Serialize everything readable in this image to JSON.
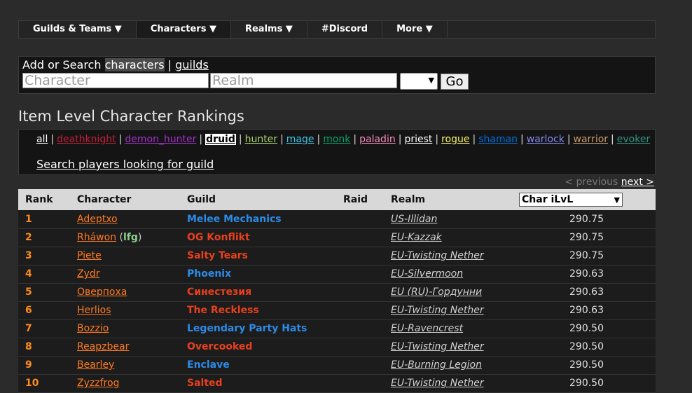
{
  "nav": {
    "items": [
      {
        "label": "Guilds & Teams ▼"
      },
      {
        "label": "Characters ▼"
      },
      {
        "label": "Realms ▼"
      },
      {
        "label": "#Discord"
      },
      {
        "label": "More ▼"
      }
    ]
  },
  "search": {
    "prefix": "Add or Search",
    "characters_link": "characters",
    "separator": "|",
    "guilds_link": "guilds",
    "character_placeholder": "Character",
    "realm_placeholder": "Realm",
    "region_value": "",
    "go_label": "Go"
  },
  "page_title": "Item Level Character Rankings",
  "classes": {
    "items": [
      {
        "label": "all",
        "color": "#ffffff"
      },
      {
        "label": "deathknight",
        "color": "#c41e3a"
      },
      {
        "label": "demon_hunter",
        "color": "#a330c9"
      },
      {
        "label": "druid",
        "color": "#000000"
      },
      {
        "label": "hunter",
        "color": "#aad372"
      },
      {
        "label": "mage",
        "color": "#3fc7eb"
      },
      {
        "label": "monk",
        "color": "#00a36c"
      },
      {
        "label": "paladin",
        "color": "#f48cba"
      },
      {
        "label": "priest",
        "color": "#ffffff"
      },
      {
        "label": "rogue",
        "color": "#fff468"
      },
      {
        "label": "shaman",
        "color": "#0070dd"
      },
      {
        "label": "warlock",
        "color": "#8788ee"
      },
      {
        "label": "warrior",
        "color": "#c69b6d"
      },
      {
        "label": "evoker",
        "color": "#33937f"
      }
    ],
    "lfg_link": "Search players looking for guild"
  },
  "pager": {
    "previous": "< previous",
    "next": "next >"
  },
  "table": {
    "headers": {
      "rank": "Rank",
      "character": "Character",
      "guild": "Guild",
      "raid": "Raid",
      "realm": "Realm"
    },
    "sort_selected": "Char iLvL",
    "rows": [
      {
        "rank": "1",
        "character": "Adeptxo",
        "lfg": "",
        "guild": "Melee Mechanics",
        "guild_color": "#2b8be8",
        "raid": "",
        "realm": "US-Illidan",
        "ilvl": "290.75"
      },
      {
        "rank": "2",
        "character": "Rháwon",
        "lfg": "lfg",
        "guild": "OG Konflikt",
        "guild_color": "#e8401c",
        "raid": "",
        "realm": "EU-Kazzak",
        "ilvl": "290.75"
      },
      {
        "rank": "3",
        "character": "Piete",
        "lfg": "",
        "guild": "Salty Tears",
        "guild_color": "#e8401c",
        "raid": "",
        "realm": "EU-Twisting Nether",
        "ilvl": "290.75"
      },
      {
        "rank": "4",
        "character": "Zydr",
        "lfg": "",
        "guild": "Phoenix",
        "guild_color": "#2b8be8",
        "raid": "",
        "realm": "EU-Silvermoon",
        "ilvl": "290.63"
      },
      {
        "rank": "5",
        "character": "Оверпоха",
        "lfg": "",
        "guild": "Синестезия",
        "guild_color": "#e8401c",
        "raid": "",
        "realm": "EU (RU)-Гордунни",
        "ilvl": "290.63"
      },
      {
        "rank": "6",
        "character": "Herlios",
        "lfg": "",
        "guild": "The Reckless",
        "guild_color": "#e8401c",
        "raid": "",
        "realm": "EU-Twisting Nether",
        "ilvl": "290.63"
      },
      {
        "rank": "7",
        "character": "Bozzio",
        "lfg": "",
        "guild": "Legendary Party Hats",
        "guild_color": "#2b8be8",
        "raid": "",
        "realm": "EU-Ravencrest",
        "ilvl": "290.50"
      },
      {
        "rank": "8",
        "character": "Reapzbear",
        "lfg": "",
        "guild": "Overcooked",
        "guild_color": "#e8401c",
        "raid": "",
        "realm": "EU-Twisting Nether",
        "ilvl": "290.50"
      },
      {
        "rank": "9",
        "character": "Bearley",
        "lfg": "",
        "guild": "Enclave",
        "guild_color": "#2b8be8",
        "raid": "",
        "realm": "EU-Burning Legion",
        "ilvl": "290.50"
      },
      {
        "rank": "10",
        "character": "Zyzzfrog",
        "lfg": "",
        "guild": "Salted",
        "guild_color": "#e8401c",
        "raid": "",
        "realm": "EU-Twisting Nether",
        "ilvl": "290.50"
      }
    ]
  }
}
